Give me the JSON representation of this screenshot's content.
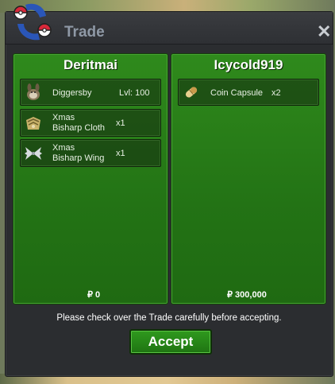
{
  "window": {
    "title": "Trade",
    "close_label": "✕"
  },
  "left": {
    "player": "Deritmai",
    "items": [
      {
        "icon": "diggersby-icon",
        "name": "Diggersby",
        "level": "Lvl: 100"
      },
      {
        "icon": "bisharp-cloth-icon",
        "line1": "Xmas",
        "line2": "Bisharp Cloth",
        "qty": "x1"
      },
      {
        "icon": "bisharp-wing-icon",
        "line1": "Xmas",
        "line2": "Bisharp Wing",
        "qty": "x1"
      }
    ],
    "money": "₽ 0"
  },
  "right": {
    "player": "Icycold919",
    "items": [
      {
        "icon": "coin-capsule-icon",
        "name": "Coin Capsule",
        "qty": "x2"
      }
    ],
    "money": "₽ 300,000"
  },
  "notice": "Please check over the Trade carefully before accepting.",
  "accept_label": "Accept",
  "colors": {
    "panel_green": "#237315",
    "accept_green": "#2f9a1e",
    "window_bg": "#2b2d30"
  }
}
